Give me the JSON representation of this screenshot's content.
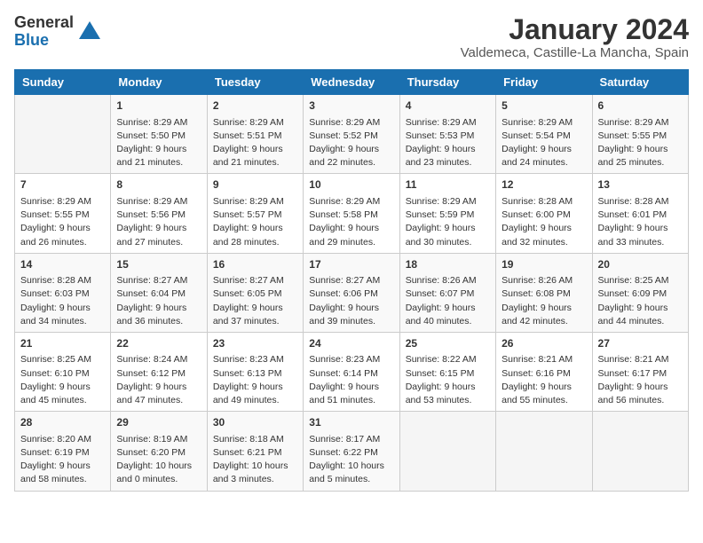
{
  "logo": {
    "general": "General",
    "blue": "Blue"
  },
  "title": "January 2024",
  "location": "Valdemeca, Castille-La Mancha, Spain",
  "days_of_week": [
    "Sunday",
    "Monday",
    "Tuesday",
    "Wednesday",
    "Thursday",
    "Friday",
    "Saturday"
  ],
  "weeks": [
    [
      {
        "day": "",
        "info": ""
      },
      {
        "day": "1",
        "info": "Sunrise: 8:29 AM\nSunset: 5:50 PM\nDaylight: 9 hours\nand 21 minutes."
      },
      {
        "day": "2",
        "info": "Sunrise: 8:29 AM\nSunset: 5:51 PM\nDaylight: 9 hours\nand 21 minutes."
      },
      {
        "day": "3",
        "info": "Sunrise: 8:29 AM\nSunset: 5:52 PM\nDaylight: 9 hours\nand 22 minutes."
      },
      {
        "day": "4",
        "info": "Sunrise: 8:29 AM\nSunset: 5:53 PM\nDaylight: 9 hours\nand 23 minutes."
      },
      {
        "day": "5",
        "info": "Sunrise: 8:29 AM\nSunset: 5:54 PM\nDaylight: 9 hours\nand 24 minutes."
      },
      {
        "day": "6",
        "info": "Sunrise: 8:29 AM\nSunset: 5:55 PM\nDaylight: 9 hours\nand 25 minutes."
      }
    ],
    [
      {
        "day": "7",
        "info": "Sunrise: 8:29 AM\nSunset: 5:55 PM\nDaylight: 9 hours\nand 26 minutes."
      },
      {
        "day": "8",
        "info": "Sunrise: 8:29 AM\nSunset: 5:56 PM\nDaylight: 9 hours\nand 27 minutes."
      },
      {
        "day": "9",
        "info": "Sunrise: 8:29 AM\nSunset: 5:57 PM\nDaylight: 9 hours\nand 28 minutes."
      },
      {
        "day": "10",
        "info": "Sunrise: 8:29 AM\nSunset: 5:58 PM\nDaylight: 9 hours\nand 29 minutes."
      },
      {
        "day": "11",
        "info": "Sunrise: 8:29 AM\nSunset: 5:59 PM\nDaylight: 9 hours\nand 30 minutes."
      },
      {
        "day": "12",
        "info": "Sunrise: 8:28 AM\nSunset: 6:00 PM\nDaylight: 9 hours\nand 32 minutes."
      },
      {
        "day": "13",
        "info": "Sunrise: 8:28 AM\nSunset: 6:01 PM\nDaylight: 9 hours\nand 33 minutes."
      }
    ],
    [
      {
        "day": "14",
        "info": "Sunrise: 8:28 AM\nSunset: 6:03 PM\nDaylight: 9 hours\nand 34 minutes."
      },
      {
        "day": "15",
        "info": "Sunrise: 8:27 AM\nSunset: 6:04 PM\nDaylight: 9 hours\nand 36 minutes."
      },
      {
        "day": "16",
        "info": "Sunrise: 8:27 AM\nSunset: 6:05 PM\nDaylight: 9 hours\nand 37 minutes."
      },
      {
        "day": "17",
        "info": "Sunrise: 8:27 AM\nSunset: 6:06 PM\nDaylight: 9 hours\nand 39 minutes."
      },
      {
        "day": "18",
        "info": "Sunrise: 8:26 AM\nSunset: 6:07 PM\nDaylight: 9 hours\nand 40 minutes."
      },
      {
        "day": "19",
        "info": "Sunrise: 8:26 AM\nSunset: 6:08 PM\nDaylight: 9 hours\nand 42 minutes."
      },
      {
        "day": "20",
        "info": "Sunrise: 8:25 AM\nSunset: 6:09 PM\nDaylight: 9 hours\nand 44 minutes."
      }
    ],
    [
      {
        "day": "21",
        "info": "Sunrise: 8:25 AM\nSunset: 6:10 PM\nDaylight: 9 hours\nand 45 minutes."
      },
      {
        "day": "22",
        "info": "Sunrise: 8:24 AM\nSunset: 6:12 PM\nDaylight: 9 hours\nand 47 minutes."
      },
      {
        "day": "23",
        "info": "Sunrise: 8:23 AM\nSunset: 6:13 PM\nDaylight: 9 hours\nand 49 minutes."
      },
      {
        "day": "24",
        "info": "Sunrise: 8:23 AM\nSunset: 6:14 PM\nDaylight: 9 hours\nand 51 minutes."
      },
      {
        "day": "25",
        "info": "Sunrise: 8:22 AM\nSunset: 6:15 PM\nDaylight: 9 hours\nand 53 minutes."
      },
      {
        "day": "26",
        "info": "Sunrise: 8:21 AM\nSunset: 6:16 PM\nDaylight: 9 hours\nand 55 minutes."
      },
      {
        "day": "27",
        "info": "Sunrise: 8:21 AM\nSunset: 6:17 PM\nDaylight: 9 hours\nand 56 minutes."
      }
    ],
    [
      {
        "day": "28",
        "info": "Sunrise: 8:20 AM\nSunset: 6:19 PM\nDaylight: 9 hours\nand 58 minutes."
      },
      {
        "day": "29",
        "info": "Sunrise: 8:19 AM\nSunset: 6:20 PM\nDaylight: 10 hours\nand 0 minutes."
      },
      {
        "day": "30",
        "info": "Sunrise: 8:18 AM\nSunset: 6:21 PM\nDaylight: 10 hours\nand 3 minutes."
      },
      {
        "day": "31",
        "info": "Sunrise: 8:17 AM\nSunset: 6:22 PM\nDaylight: 10 hours\nand 5 minutes."
      },
      {
        "day": "",
        "info": ""
      },
      {
        "day": "",
        "info": ""
      },
      {
        "day": "",
        "info": ""
      }
    ]
  ]
}
